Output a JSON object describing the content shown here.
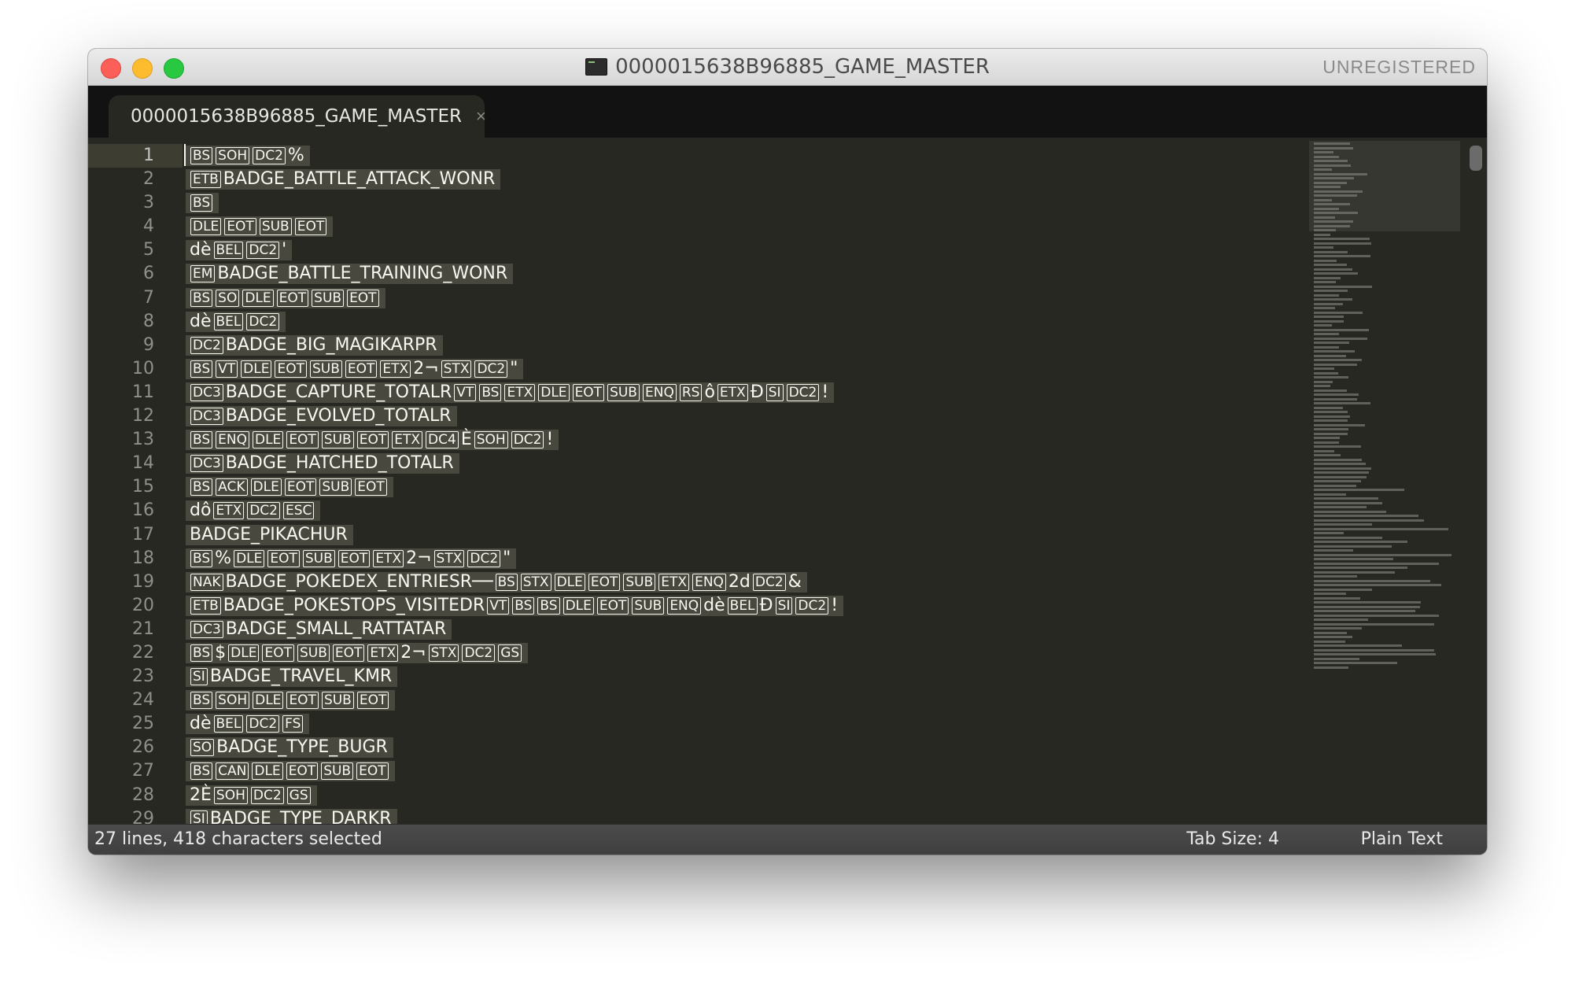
{
  "window": {
    "title": "0000015638B96885_GAME_MASTER",
    "registration": "UNREGISTERED"
  },
  "tab": {
    "label": "0000015638B96885_GAME_MASTER",
    "close": "×"
  },
  "lines": [
    {
      "n": "1",
      "parts": [
        {
          "c": "BS"
        },
        {
          "c": "SOH"
        },
        {
          "c": "DC2"
        },
        {
          "t": "%"
        }
      ]
    },
    {
      "n": "2",
      "parts": [
        {
          "c": "ETB"
        },
        {
          "t": "BADGE_BATTLE_ATTACK_WONR"
        }
      ]
    },
    {
      "n": "3",
      "parts": [
        {
          "c": "BS"
        }
      ]
    },
    {
      "n": "4",
      "parts": [
        {
          "c": "DLE"
        },
        {
          "c": "EOT"
        },
        {
          "c": "SUB"
        },
        {
          "c": "EOT"
        }
      ]
    },
    {
      "n": "5",
      "parts": [
        {
          "t": "dè"
        },
        {
          "c": "BEL"
        },
        {
          "c": "DC2"
        },
        {
          "t": "'"
        }
      ]
    },
    {
      "n": "6",
      "parts": [
        {
          "c": "EM"
        },
        {
          "t": "BADGE_BATTLE_TRAINING_WONR"
        }
      ]
    },
    {
      "n": "7",
      "parts": [
        {
          "c": "BS"
        },
        {
          "c": "SO"
        },
        {
          "c": "DLE"
        },
        {
          "c": "EOT"
        },
        {
          "c": "SUB"
        },
        {
          "c": "EOT"
        }
      ]
    },
    {
      "n": "8",
      "parts": [
        {
          "t": "dè"
        },
        {
          "c": "BEL"
        },
        {
          "c": "DC2"
        }
      ]
    },
    {
      "n": "9",
      "parts": [
        {
          "c": "DC2"
        },
        {
          "t": "BADGE_BIG_MAGIKARPR"
        }
      ]
    },
    {
      "n": "10",
      "parts": [
        {
          "c": "BS"
        },
        {
          "c": "VT"
        },
        {
          "c": "DLE"
        },
        {
          "c": "EOT"
        },
        {
          "c": "SUB"
        },
        {
          "c": "EOT"
        },
        {
          "c": "ETX"
        },
        {
          "t": "2¬"
        },
        {
          "c": "STX"
        },
        {
          "c": "DC2"
        },
        {
          "t": "\""
        }
      ]
    },
    {
      "n": "11",
      "parts": [
        {
          "c": "DC3"
        },
        {
          "t": "BADGE_CAPTURE_TOTALR"
        },
        {
          "c": "VT"
        },
        {
          "c": "BS"
        },
        {
          "c": "ETX"
        },
        {
          "c": "DLE"
        },
        {
          "c": "EOT"
        },
        {
          "c": "SUB"
        },
        {
          "c": "ENQ"
        },
        {
          "c": "RS"
        },
        {
          "t": "ô"
        },
        {
          "c": "ETX"
        },
        {
          "t": "Ð"
        },
        {
          "c": "SI"
        },
        {
          "c": "DC2"
        },
        {
          "t": "!"
        }
      ]
    },
    {
      "n": "12",
      "parts": [
        {
          "c": "DC3"
        },
        {
          "t": "BADGE_EVOLVED_TOTALR"
        }
      ]
    },
    {
      "n": "13",
      "parts": [
        {
          "c": "BS"
        },
        {
          "c": "ENQ"
        },
        {
          "c": "DLE"
        },
        {
          "c": "EOT"
        },
        {
          "c": "SUB"
        },
        {
          "c": "EOT"
        },
        {
          "c": "ETX"
        },
        {
          "c": "DC4"
        },
        {
          "t": "È"
        },
        {
          "c": "SOH"
        },
        {
          "c": "DC2"
        },
        {
          "t": "!"
        }
      ]
    },
    {
      "n": "14",
      "parts": [
        {
          "c": "DC3"
        },
        {
          "t": "BADGE_HATCHED_TOTALR"
        }
      ]
    },
    {
      "n": "15",
      "parts": [
        {
          "c": "BS"
        },
        {
          "c": "ACK"
        },
        {
          "c": "DLE"
        },
        {
          "c": "EOT"
        },
        {
          "c": "SUB"
        },
        {
          "c": "EOT"
        }
      ]
    },
    {
      "n": "16",
      "parts": [
        {
          "t": "dô"
        },
        {
          "c": "ETX"
        },
        {
          "c": "DC2"
        },
        {
          "c": "ESC"
        }
      ]
    },
    {
      "n": "17",
      "parts": [
        {
          "t": "BADGE_PIKACHUR"
        }
      ]
    },
    {
      "n": "18",
      "parts": [
        {
          "c": "BS"
        },
        {
          "t": "%"
        },
        {
          "c": "DLE"
        },
        {
          "c": "EOT"
        },
        {
          "c": "SUB"
        },
        {
          "c": "EOT"
        },
        {
          "c": "ETX"
        },
        {
          "t": "2¬"
        },
        {
          "c": "STX"
        },
        {
          "c": "DC2"
        },
        {
          "t": "\""
        }
      ]
    },
    {
      "n": "19",
      "parts": [
        {
          "c": "NAK"
        },
        {
          "t": "BADGE_POKEDEX_ENTRIESR──"
        },
        {
          "c": "BS"
        },
        {
          "c": "STX"
        },
        {
          "c": "DLE"
        },
        {
          "c": "EOT"
        },
        {
          "c": "SUB"
        },
        {
          "c": "ETX"
        },
        {
          "c": "ENQ"
        },
        {
          "t": "2d"
        },
        {
          "c": "DC2"
        },
        {
          "t": "&"
        }
      ]
    },
    {
      "n": "20",
      "parts": [
        {
          "c": "ETB"
        },
        {
          "t": "BADGE_POKESTOPS_VISITEDR"
        },
        {
          "c": "VT"
        },
        {
          "c": "BS"
        },
        {
          "c": "BS"
        },
        {
          "c": "DLE"
        },
        {
          "c": "EOT"
        },
        {
          "c": "SUB"
        },
        {
          "c": "ENQ"
        },
        {
          "t": "dè"
        },
        {
          "c": "BEL"
        },
        {
          "t": "Ð"
        },
        {
          "c": "SI"
        },
        {
          "c": "DC2"
        },
        {
          "t": "!"
        }
      ]
    },
    {
      "n": "21",
      "parts": [
        {
          "c": "DC3"
        },
        {
          "t": "BADGE_SMALL_RATTATAR"
        }
      ]
    },
    {
      "n": "22",
      "parts": [
        {
          "c": "BS"
        },
        {
          "t": "$"
        },
        {
          "c": "DLE"
        },
        {
          "c": "EOT"
        },
        {
          "c": "SUB"
        },
        {
          "c": "EOT"
        },
        {
          "c": "ETX"
        },
        {
          "t": "2¬"
        },
        {
          "c": "STX"
        },
        {
          "c": "DC2"
        },
        {
          "c": "GS"
        }
      ]
    },
    {
      "n": "23",
      "parts": [
        {
          "c": "SI"
        },
        {
          "t": "BADGE_TRAVEL_KMR"
        }
      ]
    },
    {
      "n": "24",
      "parts": [
        {
          "c": "BS"
        },
        {
          "c": "SOH"
        },
        {
          "c": "DLE"
        },
        {
          "c": "EOT"
        },
        {
          "c": "SUB"
        },
        {
          "c": "EOT"
        }
      ]
    },
    {
      "n": "25",
      "parts": [
        {
          "t": "dè"
        },
        {
          "c": "BEL"
        },
        {
          "c": "DC2"
        },
        {
          "c": "FS"
        }
      ]
    },
    {
      "n": "26",
      "parts": [
        {
          "c": "SO"
        },
        {
          "t": "BADGE_TYPE_BUGR"
        }
      ]
    },
    {
      "n": "27",
      "parts": [
        {
          "c": "BS"
        },
        {
          "c": "CAN"
        },
        {
          "c": "DLE"
        },
        {
          "c": "EOT"
        },
        {
          "c": "SUB"
        },
        {
          "c": "EOT"
        }
      ]
    },
    {
      "n": "28",
      "parts": [
        {
          "t": "2È"
        },
        {
          "c": "SOH"
        },
        {
          "c": "DC2"
        },
        {
          "c": "GS"
        }
      ]
    },
    {
      "n": "29",
      "parts": [
        {
          "c": "SI"
        },
        {
          "t": "BADGE_TYPE_DARKR"
        }
      ]
    }
  ],
  "status": {
    "selection": "27 lines, 418 characters selected",
    "tab_size": "Tab Size: 4",
    "syntax": "Plain Text"
  },
  "colors": {
    "editor_bg": "#272822",
    "selection_bg": "#49483e",
    "foreground": "#f8f8f2",
    "line_number": "#8f908a"
  }
}
